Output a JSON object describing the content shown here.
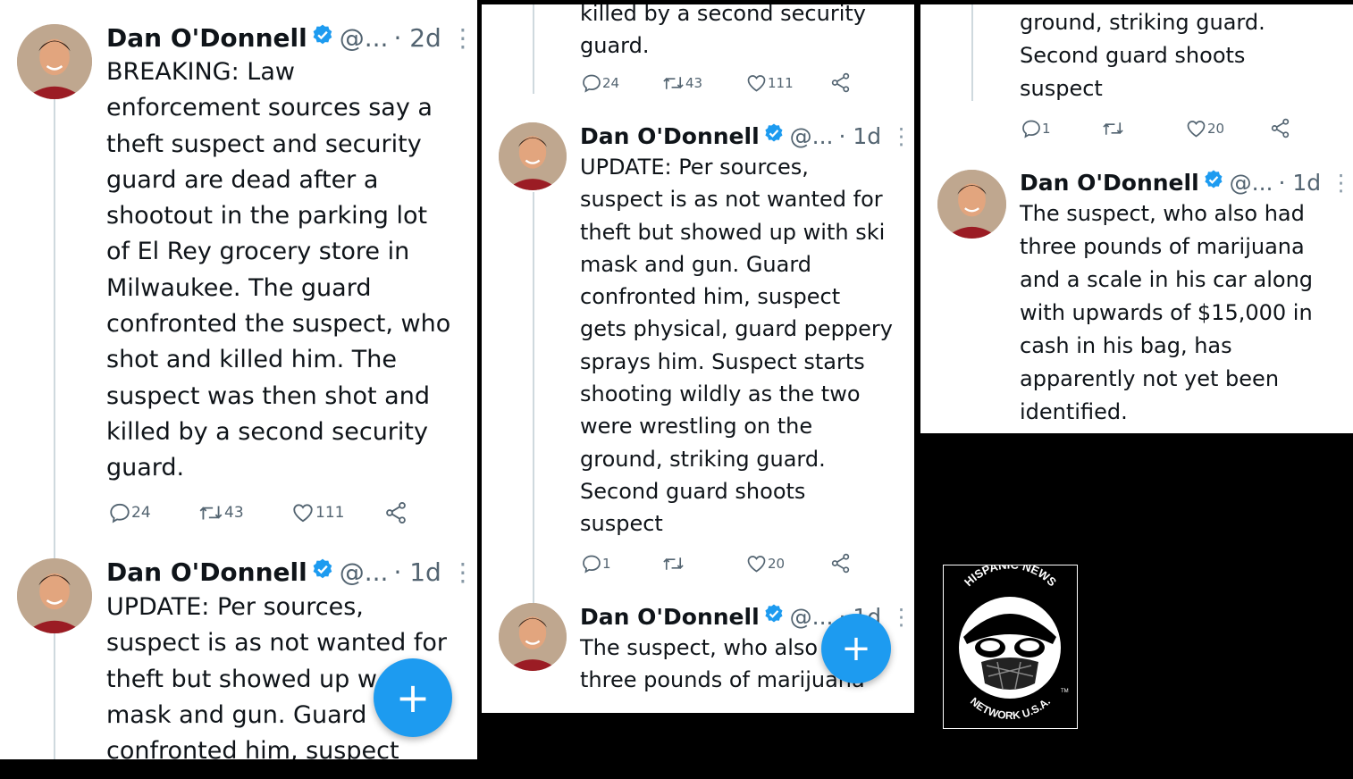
{
  "author": {
    "name": "Dan O'Donnell",
    "handle": "@...",
    "verified": true
  },
  "icons": {
    "reply": "reply-icon",
    "retweet": "retweet-icon",
    "like": "heart-icon",
    "share": "share-icon",
    "compose": "compose-plus-icon",
    "more": "more-vert-icon",
    "verified": "verified-badge-icon"
  },
  "colors": {
    "accent": "#1d9bf0",
    "text": "#0f1419",
    "muted": "#536471"
  },
  "panel1": {
    "tweet1": {
      "time": "· 2d",
      "text": "BREAKING: Law\nenforcement sources say a\ntheft suspect and security\nguard are dead after a\nshootout in the parking lot\nof El Rey grocery store in\nMilwaukee. The guard\nconfronted the suspect, who\nshot and killed him. The\nsuspect was then shot and\nkilled by a second security\nguard.",
      "replies": "24",
      "retweets": "43",
      "likes": "111"
    },
    "tweet2": {
      "time": "· 1d",
      "text": "UPDATE: Per sources,\nsuspect is as not wanted for\ntheft but showed up w\nmask and gun. Guard\nconfronted him, suspect"
    },
    "fab_label": "+"
  },
  "panel2": {
    "top_text": "killed by a second security\nguard.",
    "top_actions": {
      "replies": "24",
      "retweets": "43",
      "likes": "111"
    },
    "tweet1": {
      "time": "· 1d",
      "text": "UPDATE: Per sources,\nsuspect is as not wanted for\ntheft but showed up with ski\nmask and gun. Guard\nconfronted him, suspect\ngets physical, guard peppery\nsprays him. Suspect starts\nshooting wildly as the two\nwere wrestling on the\nground, striking guard.\nSecond guard shoots\nsuspect",
      "replies": "1",
      "retweets": "",
      "likes": "20"
    },
    "tweet2": {
      "time": "· 1d",
      "text": "The suspect, who also\nthree pounds of marijuana"
    },
    "fab_label": "+"
  },
  "panel3": {
    "top_text": "ground, striking guard.\nSecond guard shoots\nsuspect",
    "top_actions": {
      "replies": "1",
      "retweets": "",
      "likes": "20"
    },
    "tweet1": {
      "time": "· 1d",
      "text": "The suspect, who also had\nthree pounds of marijuana\nand a scale in his car along\nwith upwards of $15,000 in\ncash in his bag, has\napparently not yet been\nidentified."
    }
  },
  "logo": {
    "top_text": "HISPANIC NEWS",
    "bottom_text": "NETWORK U.S.A.",
    "tm": "TM"
  }
}
